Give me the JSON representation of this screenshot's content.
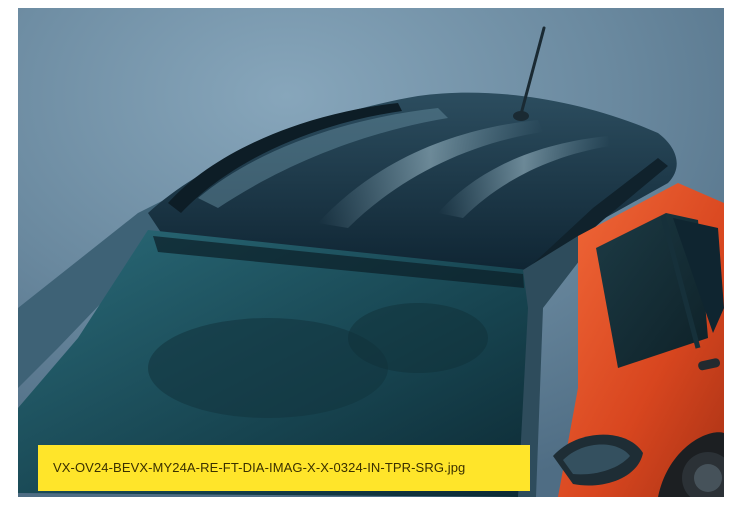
{
  "image": {
    "filename": "VX-OV24-BEVX-MY24A-RE-FT-DIA-IMAG-X-X-0324-IN-TPR-SRG.jpg",
    "subject": "car-roof-photo"
  },
  "colors": {
    "backdrop": "#6d8ba3",
    "roof": "#163242",
    "glass": "#1f5565",
    "body_paint": "#e2502a",
    "caption_background": "#ffe52a",
    "caption_text": "#3a3000"
  }
}
